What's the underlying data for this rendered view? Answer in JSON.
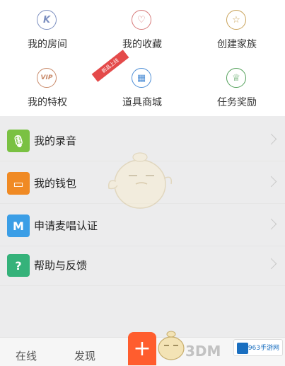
{
  "grid": {
    "items": [
      {
        "label": "我的房间",
        "glyph": "K",
        "icon": "room-icon",
        "color": "#7c8fc0"
      },
      {
        "label": "我的收藏",
        "glyph": "♡",
        "icon": "heart-icon",
        "color": "#d77a7a"
      },
      {
        "label": "创建家族",
        "glyph": "☆",
        "icon": "family-icon",
        "color": "#c9a35a"
      },
      {
        "label": "我的特权",
        "glyph": "VIP",
        "icon": "vip-icon",
        "color": "#c98a6a"
      },
      {
        "label": "道具商城",
        "glyph": "▦",
        "icon": "shop-icon",
        "color": "#4f8fd6"
      },
      {
        "label": "任务奖励",
        "glyph": "♕",
        "icon": "trophy-icon",
        "color": "#53a15a"
      }
    ],
    "ribbon_text": "新品上线"
  },
  "list": [
    {
      "label": "我的录音",
      "glyph": "🎙",
      "icon": "microphone-icon",
      "color": "#7ac143"
    },
    {
      "label": "我的钱包",
      "glyph": "▭",
      "icon": "wallet-icon",
      "color": "#f08a24"
    },
    {
      "label": "申请麦唱认证",
      "glyph": "M",
      "icon": "certify-icon",
      "color": "#3b9ee6"
    },
    {
      "label": "帮助与反馈",
      "glyph": "?",
      "icon": "help-icon",
      "color": "#35b27a"
    }
  ],
  "tabbar": {
    "tab1": "在线",
    "tab2": "发现",
    "plus": "+",
    "accent": "#ff5d2e"
  },
  "watermarks": {
    "brand": "3DM",
    "site": "963手游网"
  }
}
